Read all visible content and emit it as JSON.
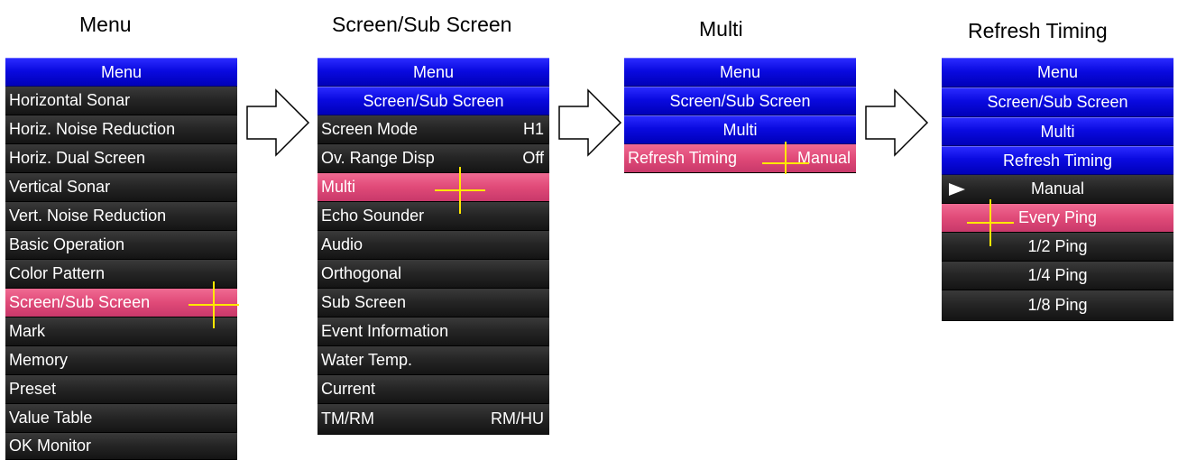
{
  "captions": [
    "Menu",
    "Screen/Sub Screen",
    "Multi",
    "Refresh Timing"
  ],
  "colors": {
    "header": "#0a0ae0",
    "item": "#262626",
    "selected": "#e04a78",
    "cursor": "#ffe800"
  },
  "panel1": {
    "header": "Menu",
    "items": [
      "Horizontal Sonar",
      "Horiz. Noise Reduction",
      "Horiz. Dual Screen",
      "Vertical Sonar",
      "Vert. Noise Reduction",
      "Basic Operation",
      "Color Pattern",
      "Screen/Sub Screen",
      "Mark",
      "Memory",
      "Preset",
      "Value Table",
      "OK Monitor"
    ],
    "selected": "Screen/Sub Screen"
  },
  "panel2": {
    "headers": [
      "Menu",
      "Screen/Sub Screen"
    ],
    "items": [
      {
        "label": "Screen Mode",
        "value": "H1"
      },
      {
        "label": "Ov. Range Disp",
        "value": "Off"
      },
      {
        "label": "Multi",
        "value": ""
      },
      {
        "label": "Echo Sounder",
        "value": ""
      },
      {
        "label": "Audio",
        "value": ""
      },
      {
        "label": "Orthogonal",
        "value": ""
      },
      {
        "label": "Sub Screen",
        "value": ""
      },
      {
        "label": "Event Information",
        "value": ""
      },
      {
        "label": "Water Temp.",
        "value": ""
      },
      {
        "label": "Current",
        "value": ""
      },
      {
        "label": "TM/RM",
        "value": "RM/HU"
      }
    ],
    "selected": "Multi"
  },
  "panel3": {
    "headers": [
      "Menu",
      "Screen/Sub Screen",
      "Multi"
    ],
    "items": [
      {
        "label": "Refresh Timing",
        "value": "Manual"
      }
    ],
    "selected": "Refresh Timing"
  },
  "panel4": {
    "headers": [
      "Menu",
      "Screen/Sub Screen",
      "Multi",
      "Refresh Timing"
    ],
    "options": [
      "Manual",
      "Every Ping",
      "1/2 Ping",
      "1/4 Ping",
      "1/8 Ping"
    ],
    "current": "Manual",
    "selected": "Every Ping"
  },
  "icons": {
    "flow_arrow": "right-arrow-outline-icon",
    "cursor": "crosshair-cursor-icon",
    "current_marker": "pointer-triangle-icon"
  }
}
